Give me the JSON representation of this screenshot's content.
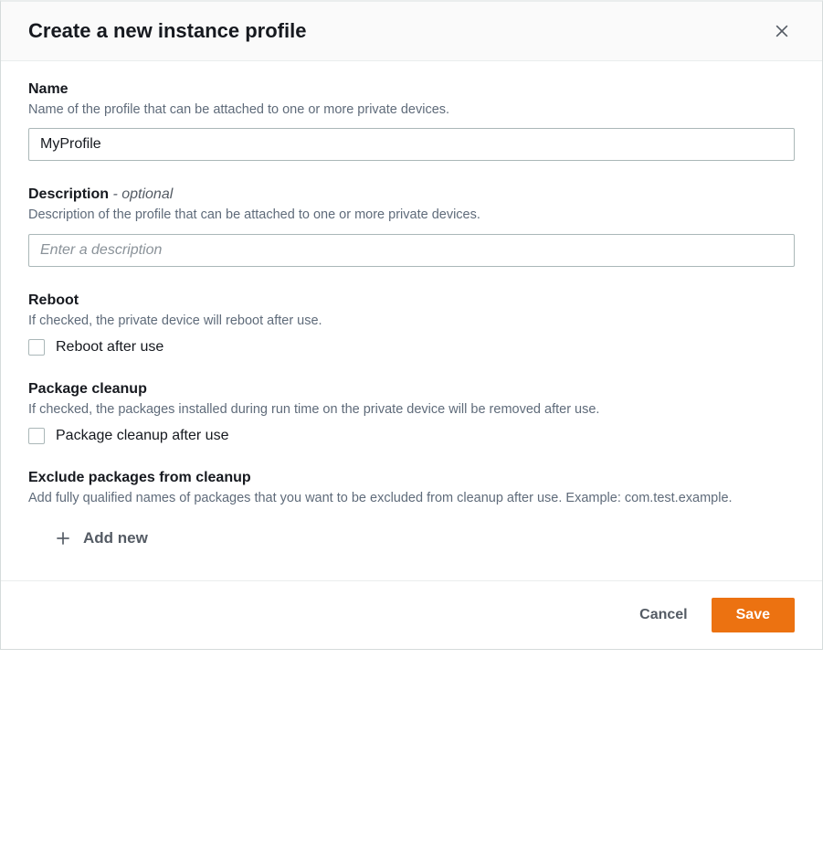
{
  "header": {
    "title": "Create a new instance profile"
  },
  "fields": {
    "name": {
      "label": "Name",
      "hint": "Name of the profile that can be attached to one or more private devices.",
      "value": "MyProfile"
    },
    "description": {
      "label": "Description",
      "optional_suffix": " - optional",
      "hint": "Description of the profile that can be attached to one or more private devices.",
      "placeholder": "Enter a description",
      "value": ""
    },
    "reboot": {
      "label": "Reboot",
      "hint": "If checked, the private device will reboot after use.",
      "checkbox_label": "Reboot after use",
      "checked": false
    },
    "package_cleanup": {
      "label": "Package cleanup",
      "hint": "If checked, the packages installed during run time on the private device will be removed after use.",
      "checkbox_label": "Package cleanup after use",
      "checked": false
    },
    "exclude_packages": {
      "label": "Exclude packages from cleanup",
      "hint": "Add fully qualified names of packages that you want to be excluded from cleanup after use. Example: com.test.example.",
      "add_button_label": "Add new"
    }
  },
  "footer": {
    "cancel_label": "Cancel",
    "save_label": "Save"
  }
}
